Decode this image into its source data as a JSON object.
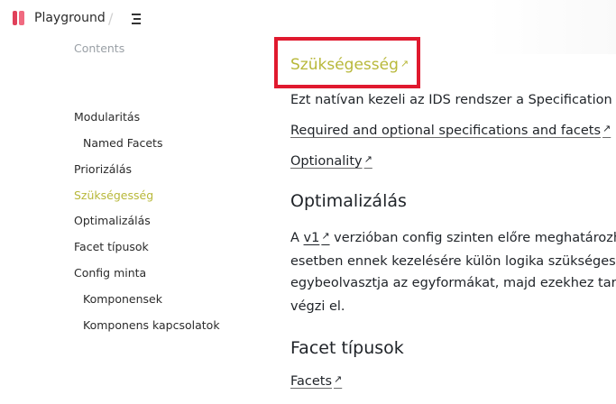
{
  "header": {
    "brand": "Playground",
    "separator": "/",
    "menu_icon": "menu-icon"
  },
  "sidebar": {
    "title": "Contents",
    "items": [
      {
        "label": "Modularitás",
        "indent": false,
        "active": false
      },
      {
        "label": "Named Facets",
        "indent": true,
        "active": false
      },
      {
        "label": "Priorizálás",
        "indent": false,
        "active": false
      },
      {
        "label": "Szükségesség",
        "indent": false,
        "active": true
      },
      {
        "label": "Optimalizálás",
        "indent": false,
        "active": false
      },
      {
        "label": "Facet típusok",
        "indent": false,
        "active": false
      },
      {
        "label": "Config minta",
        "indent": false,
        "active": false
      },
      {
        "label": "Komponensek",
        "indent": true,
        "active": false
      },
      {
        "label": "Komponens kapcsolatok",
        "indent": true,
        "active": false
      }
    ]
  },
  "main": {
    "section_heading": "Szükségesség",
    "ext_icon": "↗",
    "para1": "Ezt natívan kezeli az IDS rendszer a Specification (és",
    "link1": "Required and optional specifications and facets",
    "link2": "Optionality",
    "h_optimalizalas": "Optimalizálás",
    "opt_p1_prefix": "A ",
    "opt_p1_link": "v1",
    "opt_p1_suffix": " verzióban config szinten előre meghatározh",
    "opt_p2": "esetben ennek kezelésére külön logika szükséges, a",
    "opt_p3": "egybeolvasztja az egyformákat, majd ezekhez tartoz",
    "opt_p4": "végzi el.",
    "h_facet": "Facet típusok",
    "link3": "Facets"
  },
  "colors": {
    "accent": "#b8b83a",
    "highlight_border": "#e0192e",
    "brand_icon": "#e0405a"
  }
}
